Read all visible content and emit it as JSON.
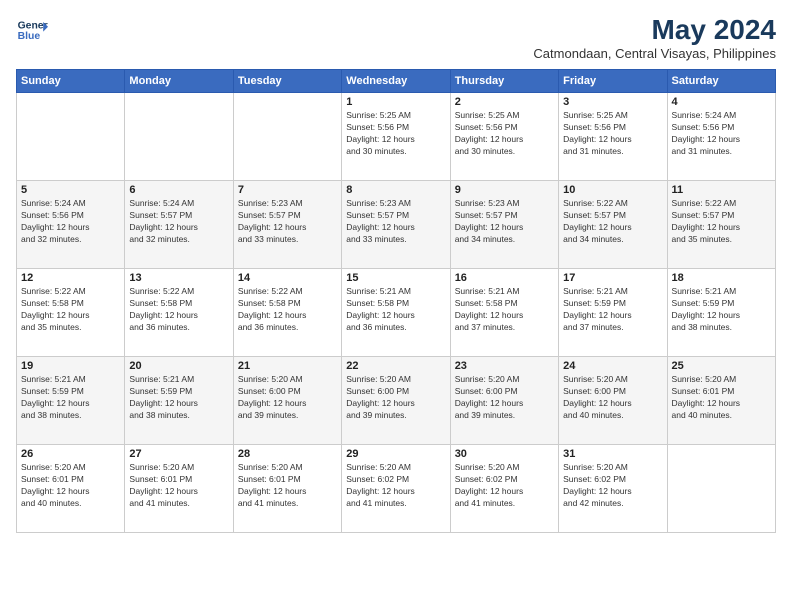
{
  "header": {
    "logo_line1": "General",
    "logo_line2": "Blue",
    "title": "May 2024",
    "subtitle": "Catmondaan, Central Visayas, Philippines"
  },
  "days_of_week": [
    "Sunday",
    "Monday",
    "Tuesday",
    "Wednesday",
    "Thursday",
    "Friday",
    "Saturday"
  ],
  "weeks": [
    [
      {
        "day": "",
        "info": ""
      },
      {
        "day": "",
        "info": ""
      },
      {
        "day": "",
        "info": ""
      },
      {
        "day": "1",
        "info": "Sunrise: 5:25 AM\nSunset: 5:56 PM\nDaylight: 12 hours\nand 30 minutes."
      },
      {
        "day": "2",
        "info": "Sunrise: 5:25 AM\nSunset: 5:56 PM\nDaylight: 12 hours\nand 30 minutes."
      },
      {
        "day": "3",
        "info": "Sunrise: 5:25 AM\nSunset: 5:56 PM\nDaylight: 12 hours\nand 31 minutes."
      },
      {
        "day": "4",
        "info": "Sunrise: 5:24 AM\nSunset: 5:56 PM\nDaylight: 12 hours\nand 31 minutes."
      }
    ],
    [
      {
        "day": "5",
        "info": "Sunrise: 5:24 AM\nSunset: 5:56 PM\nDaylight: 12 hours\nand 32 minutes."
      },
      {
        "day": "6",
        "info": "Sunrise: 5:24 AM\nSunset: 5:57 PM\nDaylight: 12 hours\nand 32 minutes."
      },
      {
        "day": "7",
        "info": "Sunrise: 5:23 AM\nSunset: 5:57 PM\nDaylight: 12 hours\nand 33 minutes."
      },
      {
        "day": "8",
        "info": "Sunrise: 5:23 AM\nSunset: 5:57 PM\nDaylight: 12 hours\nand 33 minutes."
      },
      {
        "day": "9",
        "info": "Sunrise: 5:23 AM\nSunset: 5:57 PM\nDaylight: 12 hours\nand 34 minutes."
      },
      {
        "day": "10",
        "info": "Sunrise: 5:22 AM\nSunset: 5:57 PM\nDaylight: 12 hours\nand 34 minutes."
      },
      {
        "day": "11",
        "info": "Sunrise: 5:22 AM\nSunset: 5:57 PM\nDaylight: 12 hours\nand 35 minutes."
      }
    ],
    [
      {
        "day": "12",
        "info": "Sunrise: 5:22 AM\nSunset: 5:58 PM\nDaylight: 12 hours\nand 35 minutes."
      },
      {
        "day": "13",
        "info": "Sunrise: 5:22 AM\nSunset: 5:58 PM\nDaylight: 12 hours\nand 36 minutes."
      },
      {
        "day": "14",
        "info": "Sunrise: 5:22 AM\nSunset: 5:58 PM\nDaylight: 12 hours\nand 36 minutes."
      },
      {
        "day": "15",
        "info": "Sunrise: 5:21 AM\nSunset: 5:58 PM\nDaylight: 12 hours\nand 36 minutes."
      },
      {
        "day": "16",
        "info": "Sunrise: 5:21 AM\nSunset: 5:58 PM\nDaylight: 12 hours\nand 37 minutes."
      },
      {
        "day": "17",
        "info": "Sunrise: 5:21 AM\nSunset: 5:59 PM\nDaylight: 12 hours\nand 37 minutes."
      },
      {
        "day": "18",
        "info": "Sunrise: 5:21 AM\nSunset: 5:59 PM\nDaylight: 12 hours\nand 38 minutes."
      }
    ],
    [
      {
        "day": "19",
        "info": "Sunrise: 5:21 AM\nSunset: 5:59 PM\nDaylight: 12 hours\nand 38 minutes."
      },
      {
        "day": "20",
        "info": "Sunrise: 5:21 AM\nSunset: 5:59 PM\nDaylight: 12 hours\nand 38 minutes."
      },
      {
        "day": "21",
        "info": "Sunrise: 5:20 AM\nSunset: 6:00 PM\nDaylight: 12 hours\nand 39 minutes."
      },
      {
        "day": "22",
        "info": "Sunrise: 5:20 AM\nSunset: 6:00 PM\nDaylight: 12 hours\nand 39 minutes."
      },
      {
        "day": "23",
        "info": "Sunrise: 5:20 AM\nSunset: 6:00 PM\nDaylight: 12 hours\nand 39 minutes."
      },
      {
        "day": "24",
        "info": "Sunrise: 5:20 AM\nSunset: 6:00 PM\nDaylight: 12 hours\nand 40 minutes."
      },
      {
        "day": "25",
        "info": "Sunrise: 5:20 AM\nSunset: 6:01 PM\nDaylight: 12 hours\nand 40 minutes."
      }
    ],
    [
      {
        "day": "26",
        "info": "Sunrise: 5:20 AM\nSunset: 6:01 PM\nDaylight: 12 hours\nand 40 minutes."
      },
      {
        "day": "27",
        "info": "Sunrise: 5:20 AM\nSunset: 6:01 PM\nDaylight: 12 hours\nand 41 minutes."
      },
      {
        "day": "28",
        "info": "Sunrise: 5:20 AM\nSunset: 6:01 PM\nDaylight: 12 hours\nand 41 minutes."
      },
      {
        "day": "29",
        "info": "Sunrise: 5:20 AM\nSunset: 6:02 PM\nDaylight: 12 hours\nand 41 minutes."
      },
      {
        "day": "30",
        "info": "Sunrise: 5:20 AM\nSunset: 6:02 PM\nDaylight: 12 hours\nand 41 minutes."
      },
      {
        "day": "31",
        "info": "Sunrise: 5:20 AM\nSunset: 6:02 PM\nDaylight: 12 hours\nand 42 minutes."
      },
      {
        "day": "",
        "info": ""
      }
    ]
  ]
}
